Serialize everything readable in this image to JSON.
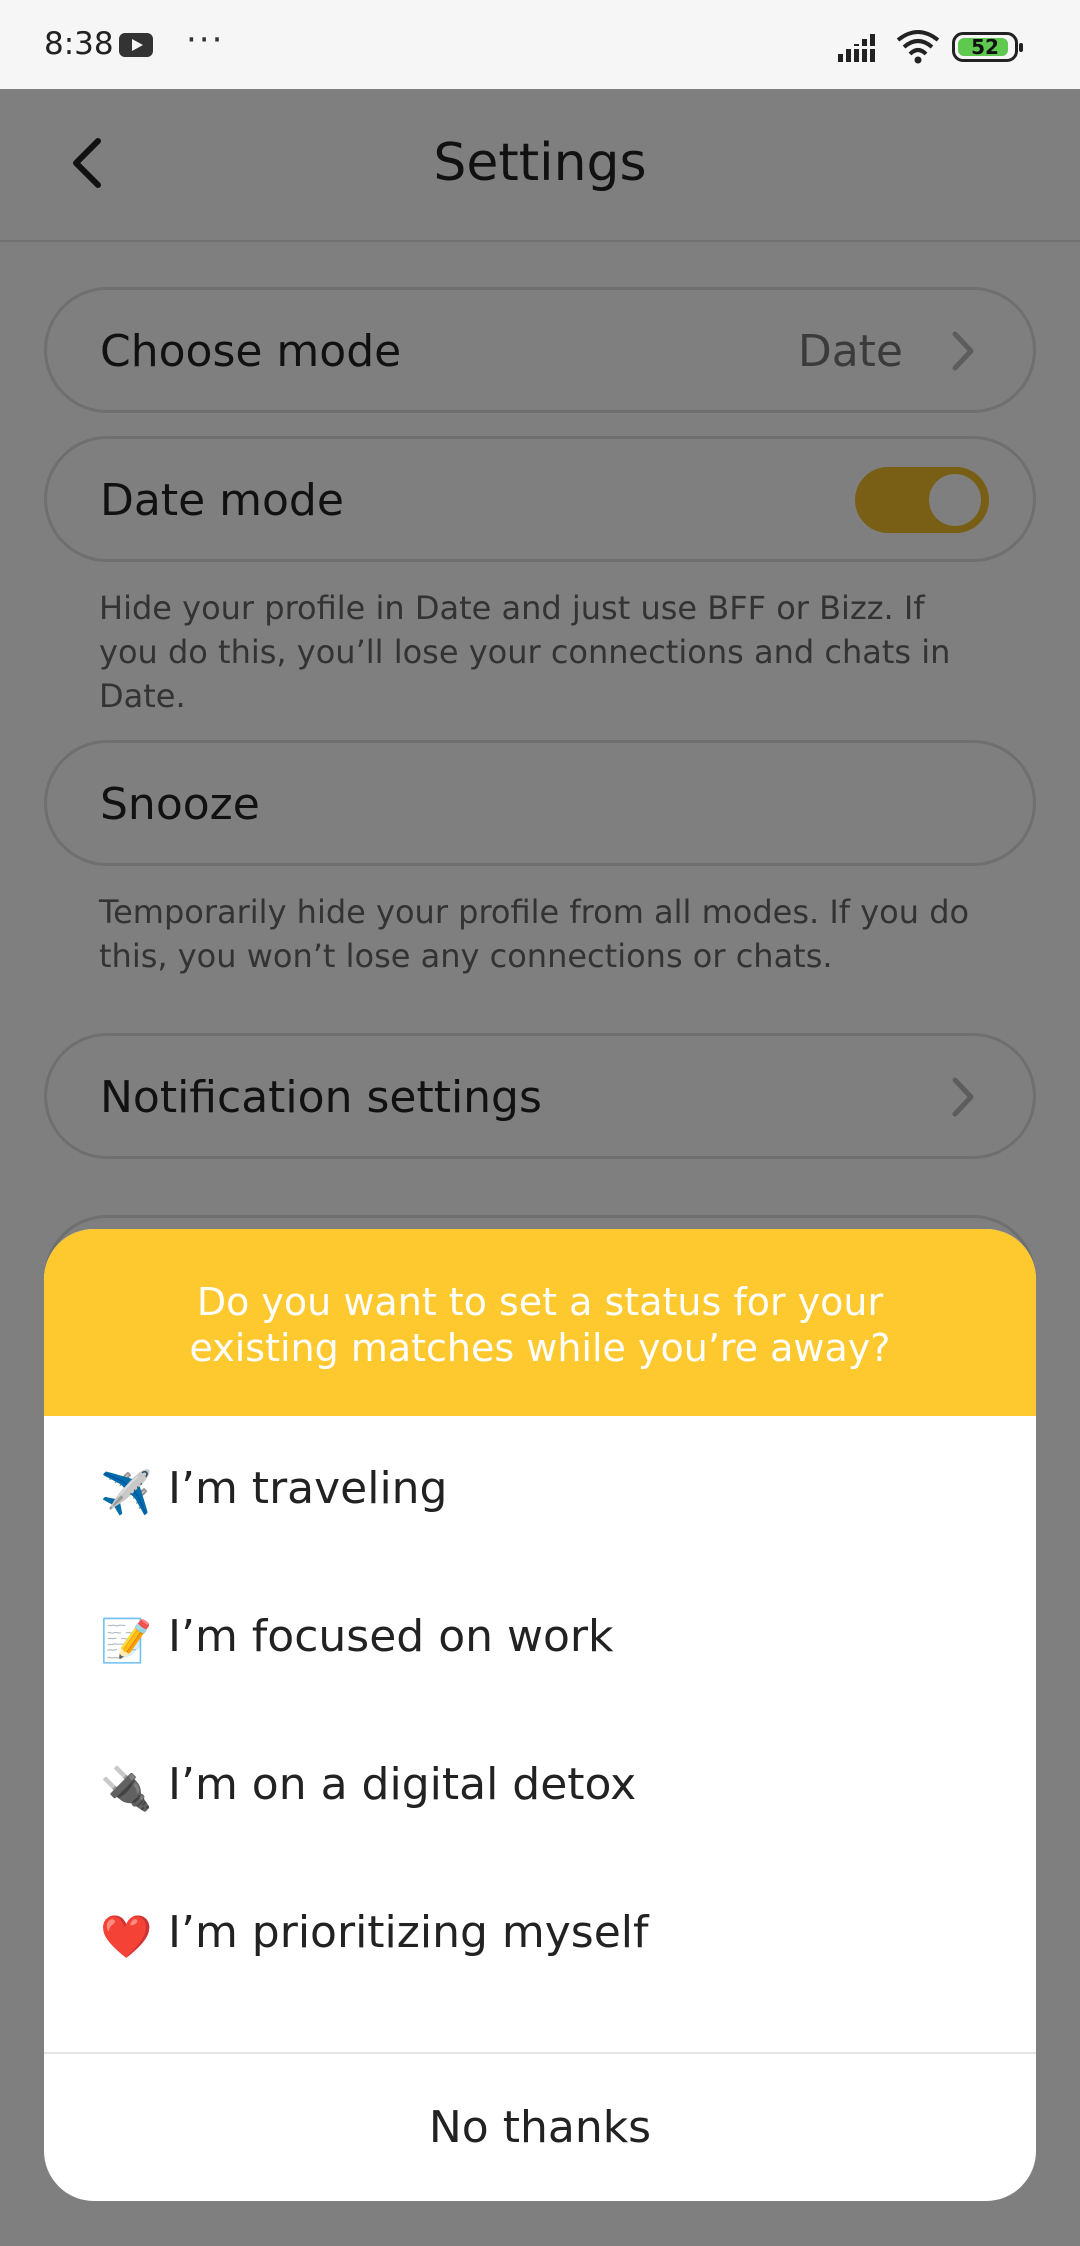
{
  "status_bar": {
    "time": "8:38",
    "battery": "52"
  },
  "header": {
    "title": "Settings"
  },
  "settings": {
    "choose_mode": {
      "label": "Choose mode",
      "value": "Date"
    },
    "date_mode": {
      "label": "Date mode",
      "toggle_on": true,
      "helper": "Hide your profile in Date and just use BFF or Bizz. If you do this, you’ll lose your connections and chats in Date."
    },
    "snooze": {
      "label": "Snooze",
      "helper": "Temporarily hide your profile from all modes. If you do this, you won’t lose any connections or chats."
    },
    "notification_settings": {
      "label": "Notification settings"
    }
  },
  "dialog": {
    "title": "Do you want to set a status for your existing matches while you’re away?",
    "options": [
      {
        "emoji": "✈️",
        "label": "I’m traveling"
      },
      {
        "emoji": "📝",
        "label": "I’m focused on work"
      },
      {
        "emoji": "🔌",
        "label": "I’m on a digital detox"
      },
      {
        "emoji": "❤️",
        "label": "I’m prioritizing myself"
      }
    ],
    "dismiss_label": "No thanks"
  },
  "colors": {
    "accent": "#fec82f",
    "toggle": "#f1bf2a",
    "scrim": "rgba(0,0,0,0.5)",
    "battery": "#5ec84f"
  },
  "icons": [
    "youtube-icon",
    "more-dots-icon",
    "signal-icon",
    "wifi-icon",
    "battery-icon",
    "back-arrow-icon",
    "chevron-right-icon",
    "airplane-icon",
    "memo-icon",
    "plug-icon",
    "heart-icon"
  ]
}
